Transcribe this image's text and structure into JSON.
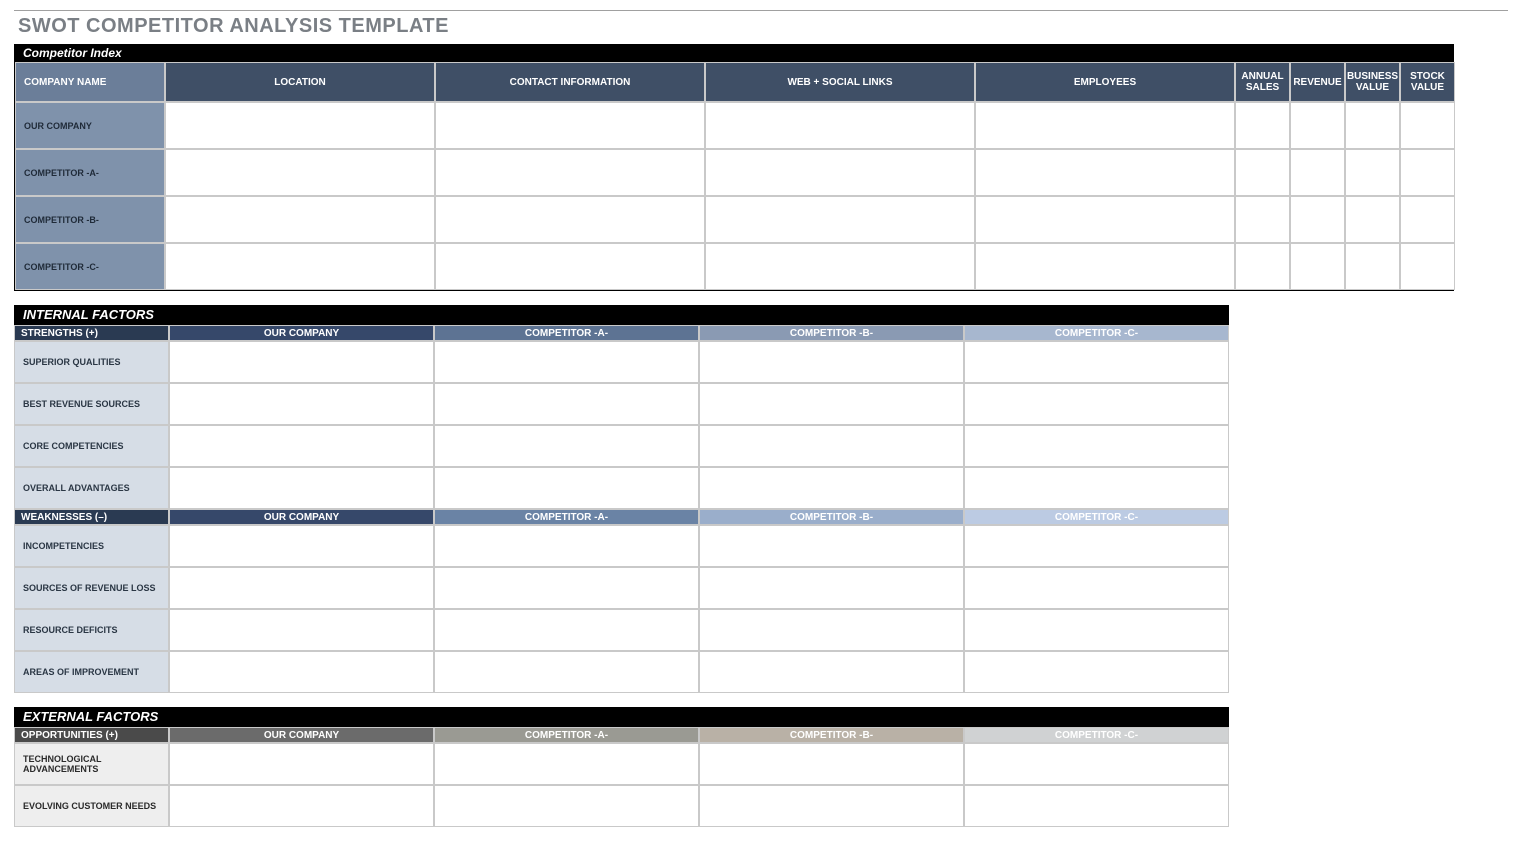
{
  "title": "SWOT COMPETITOR ANALYSIS TEMPLATE",
  "competitor_index": {
    "header": "Competitor Index",
    "columns": {
      "company_name": "COMPANY NAME",
      "location": "LOCATION",
      "contact_information": "CONTACT INFORMATION",
      "web_social": "WEB + SOCIAL LINKS",
      "employees": "EMPLOYEES",
      "annual_sales": "ANNUAL SALES",
      "revenue": "REVENUE",
      "business_value": "BUSINESS VALUE",
      "stock_value": "STOCK VALUE"
    },
    "rows": [
      {
        "label": "OUR COMPANY",
        "location": "",
        "contact": "",
        "web": "",
        "employees": "",
        "annual_sales": "",
        "revenue": "",
        "business_value": "",
        "stock_value": ""
      },
      {
        "label": "COMPETITOR -A-",
        "location": "",
        "contact": "",
        "web": "",
        "employees": "",
        "annual_sales": "",
        "revenue": "",
        "business_value": "",
        "stock_value": ""
      },
      {
        "label": "COMPETITOR -B-",
        "location": "",
        "contact": "",
        "web": "",
        "employees": "",
        "annual_sales": "",
        "revenue": "",
        "business_value": "",
        "stock_value": ""
      },
      {
        "label": "COMPETITOR -C-",
        "location": "",
        "contact": "",
        "web": "",
        "employees": "",
        "annual_sales": "",
        "revenue": "",
        "business_value": "",
        "stock_value": ""
      }
    ]
  },
  "internal_factors": {
    "header": "INTERNAL FACTORS",
    "competitor_cols": {
      "our": "OUR COMPANY",
      "a": "COMPETITOR -A-",
      "b": "COMPETITOR -B-",
      "c": "COMPETITOR -C-"
    },
    "strengths": {
      "label": "STRENGTHS (+)",
      "rows": [
        {
          "label": "SUPERIOR QUALITIES",
          "our": "",
          "a": "",
          "b": "",
          "c": ""
        },
        {
          "label": "BEST REVENUE SOURCES",
          "our": "",
          "a": "",
          "b": "",
          "c": ""
        },
        {
          "label": "CORE COMPETENCIES",
          "our": "",
          "a": "",
          "b": "",
          "c": ""
        },
        {
          "label": "OVERALL ADVANTAGES",
          "our": "",
          "a": "",
          "b": "",
          "c": ""
        }
      ]
    },
    "weaknesses": {
      "label": "WEAKNESSES (–)",
      "rows": [
        {
          "label": "INCOMPETENCIES",
          "our": "",
          "a": "",
          "b": "",
          "c": ""
        },
        {
          "label": "SOURCES OF REVENUE LOSS",
          "our": "",
          "a": "",
          "b": "",
          "c": ""
        },
        {
          "label": "RESOURCE DEFICITS",
          "our": "",
          "a": "",
          "b": "",
          "c": ""
        },
        {
          "label": "AREAS OF IMPROVEMENT",
          "our": "",
          "a": "",
          "b": "",
          "c": ""
        }
      ]
    }
  },
  "external_factors": {
    "header": "EXTERNAL FACTORS",
    "competitor_cols": {
      "our": "OUR COMPANY",
      "a": "COMPETITOR -A-",
      "b": "COMPETITOR -B-",
      "c": "COMPETITOR -C-"
    },
    "opportunities": {
      "label": "OPPORTUNITIES (+)",
      "rows": [
        {
          "label": "TECHNOLOGICAL ADVANCEMENTS",
          "our": "",
          "a": "",
          "b": "",
          "c": ""
        },
        {
          "label": "EVOLVING CUSTOMER NEEDS",
          "our": "",
          "a": "",
          "b": "",
          "c": ""
        }
      ]
    }
  }
}
